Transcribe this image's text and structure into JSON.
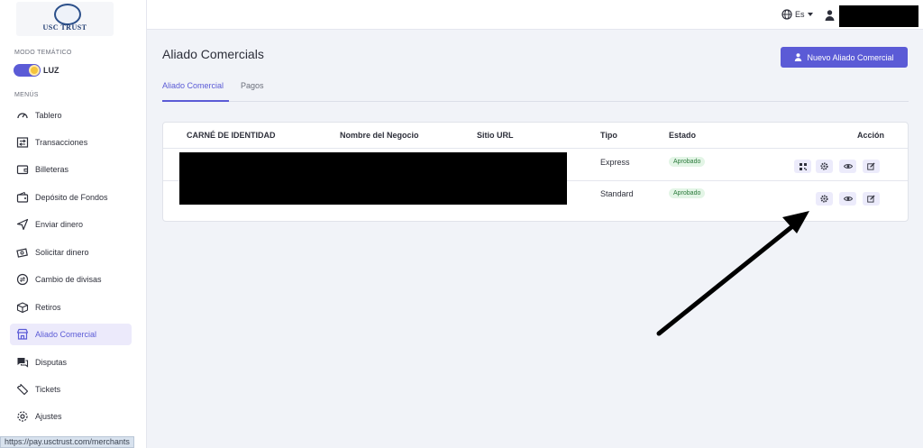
{
  "brand": {
    "logo_text": "USC TRUST"
  },
  "sidebar": {
    "theme_label": "MODO TEMÁTICO",
    "theme_value": "LUZ",
    "menu_label": "MENÚS",
    "items": [
      {
        "label": "Tablero",
        "icon": "speedometer-icon"
      },
      {
        "label": "Transacciones",
        "icon": "transfer-icon"
      },
      {
        "label": "Billeteras",
        "icon": "wallet-icon"
      },
      {
        "label": "Depósito de Fondos",
        "icon": "deposit-icon"
      },
      {
        "label": "Enviar dinero",
        "icon": "send-icon"
      },
      {
        "label": "Solicitar dinero",
        "icon": "request-money-icon"
      },
      {
        "label": "Cambio de divisas",
        "icon": "exchange-icon"
      },
      {
        "label": "Retiros",
        "icon": "box-icon"
      },
      {
        "label": "Aliado Comercial",
        "icon": "store-icon",
        "active": true
      },
      {
        "label": "Disputas",
        "icon": "chat-icon"
      },
      {
        "label": "Tickets",
        "icon": "ticket-icon"
      },
      {
        "label": "Ajustes",
        "icon": "gear-icon"
      }
    ]
  },
  "status_bar": {
    "url": "https://pay.usctrust.com/merchants"
  },
  "topbar": {
    "language": "Es"
  },
  "page": {
    "title": "Aliado Comercials",
    "new_button": "Nuevo Aliado Comercial",
    "tabs": [
      {
        "label": "Aliado Comercial",
        "active": true
      },
      {
        "label": "Pagos",
        "active": false
      }
    ]
  },
  "table": {
    "headers": [
      "CARNÉ DE IDENTIDAD",
      "Nombre del Negocio",
      "Sitio URL",
      "Tipo",
      "Estado",
      "Acción"
    ],
    "rows": [
      {
        "tipo": "Express",
        "estado": "Aprobado"
      },
      {
        "tipo": "Standard",
        "estado": "Aprobado"
      }
    ]
  },
  "colors": {
    "accent": "#5b5bd6",
    "approved_bg": "#e3f5e6",
    "approved_text": "#2b7a3b"
  }
}
